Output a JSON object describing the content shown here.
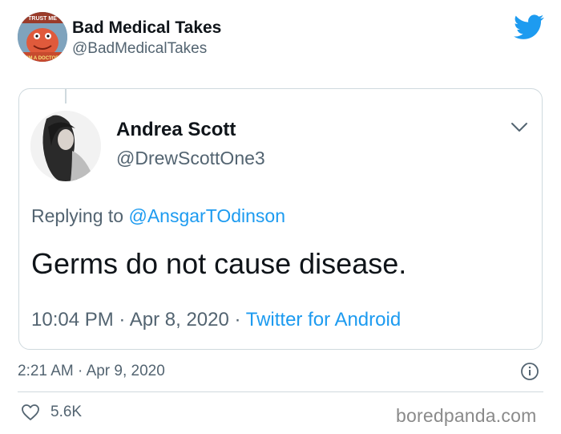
{
  "author": {
    "display_name": "Bad Medical Takes",
    "handle": "@BadMedicalTakes",
    "avatar": "zoidberg-avatar",
    "avatar_text_top": "TRUST ME",
    "avatar_text_bottom": "I'M A DOCTOR"
  },
  "platform_icon": "twitter-bird-icon",
  "quoted_tweet": {
    "display_name": "Andrea Scott",
    "handle": "@DrewScottOne3",
    "avatar": "profile-photo-avatar",
    "replying_prefix": "Replying to ",
    "replying_to": "@AnsgarTOdinson",
    "text": "Germs do not cause disease.",
    "time": "10:04 PM",
    "date": "Apr 8, 2020",
    "separator": " · ",
    "source": "Twitter for Android",
    "menu_icon": "chevron-down-icon"
  },
  "tweet_meta": {
    "time": "2:21 AM",
    "separator": " · ",
    "date": "Apr 9, 2020",
    "info_icon": "info-icon"
  },
  "engagement": {
    "like_icon": "heart-icon",
    "likes": "5.6K"
  },
  "watermark": "boredpanda.com",
  "colors": {
    "accent": "#1d9bf0",
    "muted_text": "#536471",
    "border": "#cfd9de",
    "text": "#0f1419"
  }
}
